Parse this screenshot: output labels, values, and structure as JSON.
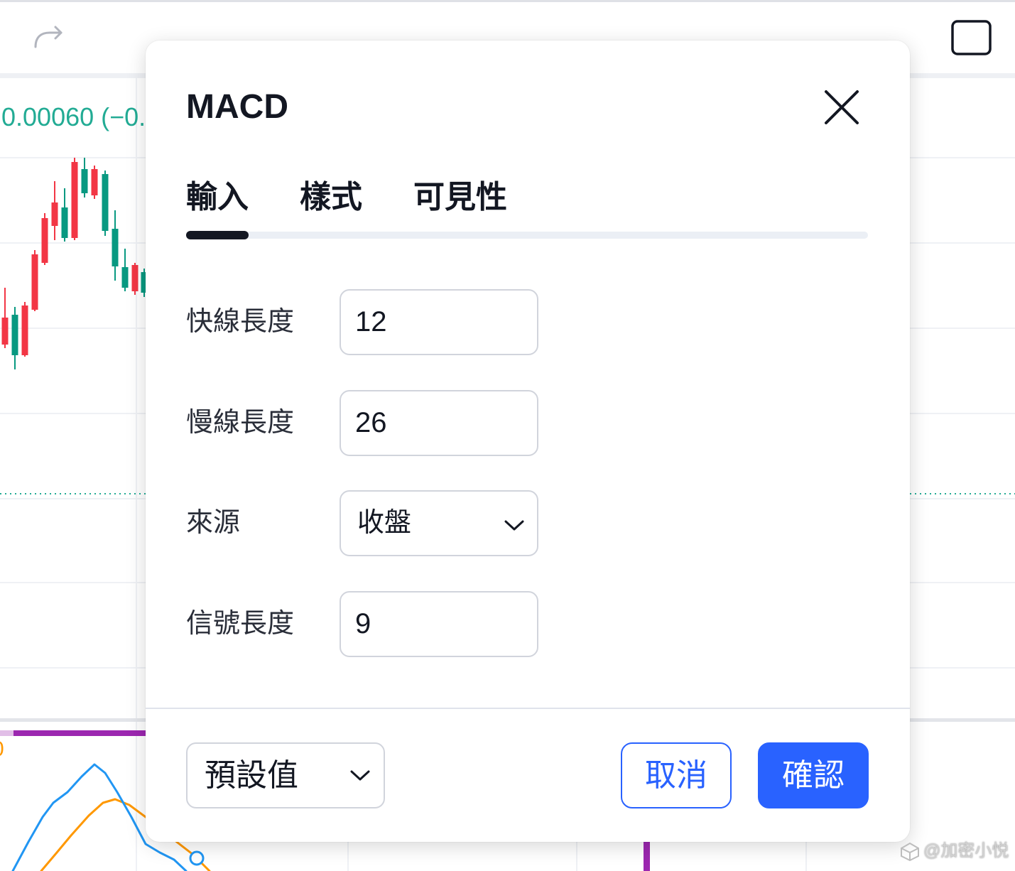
{
  "toolbar": {
    "icons": [
      "redo-icon",
      "square-icon"
    ]
  },
  "chart": {
    "price_change_label": "0.00060 (−0.",
    "lower_pane_label": "0",
    "colors": {
      "candle_red": "#f23645",
      "candle_green": "#089981",
      "price_text": "#22ab94",
      "price_line": "#22ab94",
      "macd_line": "#2196f3",
      "signal_line": "#ff9800",
      "purple": "#9c27b0",
      "purple_light": "#e1bee7"
    }
  },
  "dialog": {
    "title": "MACD",
    "close_icon": "close-icon",
    "tabs": [
      {
        "label": "輸入",
        "active": true
      },
      {
        "label": "樣式",
        "active": false
      },
      {
        "label": "可見性",
        "active": false
      }
    ],
    "inputs": [
      {
        "label": "快線長度",
        "value": 12
      },
      {
        "label": "慢線長度",
        "value": 26
      },
      {
        "label": "來源",
        "value": "收盤",
        "icon": "chevron-down-icon"
      },
      {
        "label": "信號長度",
        "value": 9
      }
    ],
    "footer": {
      "defaults_label": "預設值",
      "defaults_icon": "chevron-down-icon",
      "cancel_label": "取消",
      "confirm_label": "確認"
    },
    "colors": {
      "accent": "#2962ff",
      "text": "#131722",
      "border": "#d1d4dc"
    }
  },
  "watermark": {
    "text": "@加密小悦",
    "icon": "logo-icon"
  }
}
